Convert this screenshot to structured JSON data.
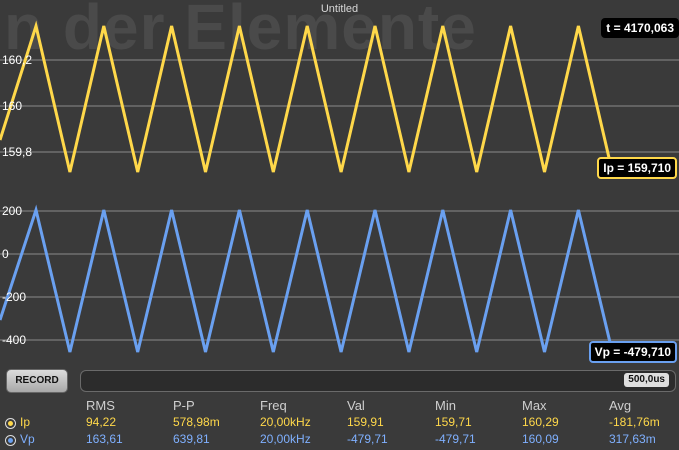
{
  "window": {
    "title": "Untitled"
  },
  "background": {
    "title_fragment": "n der Elemente"
  },
  "colors": {
    "ip": "#ffd84a",
    "vp": "#6aa0f0",
    "background": "#3a3a3a"
  },
  "ip_plot": {
    "y_ticks": [
      "160,2",
      "160",
      "159,8"
    ],
    "series_name": "Ip",
    "min": 159.71,
    "max": 160.29
  },
  "vp_plot": {
    "y_ticks": [
      "200",
      "0",
      "-200",
      "-400"
    ],
    "series_name": "Vp",
    "min": -479.71,
    "max": 160.09
  },
  "readouts": {
    "time": "t = 4170,063",
    "ip": "Ip = 159,710",
    "vp": "Vp = -479,710"
  },
  "controls": {
    "record_label": "RECORD",
    "timebase": "500,0us"
  },
  "stats": {
    "headers": [
      "RMS",
      "P-P",
      "Freq",
      "Val",
      "Min",
      "Max",
      "Avg"
    ],
    "rows": [
      {
        "name": "Ip",
        "values": [
          "94,22",
          "578,98m",
          "20,00kHz",
          "159,91",
          "159,71",
          "160,29",
          "-181,76m"
        ]
      },
      {
        "name": "Vp",
        "values": [
          "163,61",
          "639,81",
          "20,00kHz",
          "-479,71",
          "-479,71",
          "160,09",
          "317,63m"
        ]
      }
    ]
  }
}
